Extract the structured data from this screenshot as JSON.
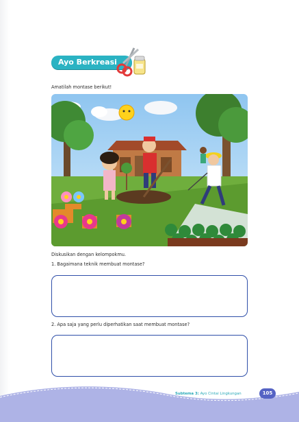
{
  "section": {
    "title": "Ayo Berkreasi",
    "icon": "scissors-glue-icon"
  },
  "instruction": "Amatilah montase berikut!",
  "montage": {
    "icon": "montage-illustration"
  },
  "discussion": {
    "intro": "Diskusikan dengan kelompokmu.",
    "questions": [
      "1.  Bagaimana teknik membuat montase?",
      "2.  Apa saja yang perlu diperhatikan saat membuat montase?"
    ]
  },
  "footer": {
    "subtheme": "Subtema 3:",
    "subtheme_title": "Ayo Cintai Lingkungan",
    "page_number": "105"
  },
  "colors": {
    "banner": "#2bb3c3",
    "box_border": "#2e4ea8",
    "footer_wave": "#aeb3e6",
    "page_badge": "#5563c4"
  }
}
